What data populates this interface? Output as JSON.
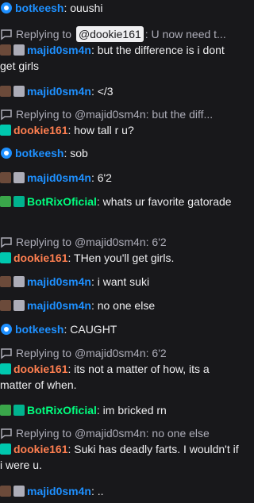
{
  "colors": {
    "background": "#18181b",
    "text": "#efeff1",
    "muted": "#adadb8",
    "botkeesh": "#1e90ff",
    "majid": "#1e90ff",
    "dookie": "#ff7f50",
    "botrix": "#00ff7f"
  },
  "messages": [
    {
      "user": "botkeesh",
      "text": ": ouushi"
    },
    {
      "reply_prefix": "Replying to",
      "reply_mention": "@dookie161",
      "reply_text": ": U now need t...",
      "user": "majid0sm4n",
      "text": ": but the difference is i dont get girls"
    },
    {
      "user": "majid0sm4n",
      "text": ": </3"
    },
    {
      "reply_prefix": "Replying to",
      "reply_text": "@majid0sm4n: but the diff...",
      "user": "dookie161",
      "text": ": how tall r u?"
    },
    {
      "user": "botkeesh",
      "text": ": sob"
    },
    {
      "user": "majid0sm4n",
      "text": ": 6'2"
    },
    {
      "user": "BotRixOficial",
      "text": ": whats ur favorite gatorade"
    },
    {
      "reply_prefix": "Replying to",
      "reply_text": "@majid0sm4n: 6'2",
      "user": "dookie161",
      "text": ": THen you'll get girls."
    },
    {
      "user": "majid0sm4n",
      "text": ": i want suki"
    },
    {
      "user": "majid0sm4n",
      "text": ": no one else"
    },
    {
      "user": "botkeesh",
      "text": ": CAUGHT"
    },
    {
      "reply_prefix": "Replying to",
      "reply_text": "@majid0sm4n: 6'2",
      "user": "dookie161",
      "text": ": its not a matter of how, its a matter of when."
    },
    {
      "user": "BotRixOficial",
      "text": ": im bricked rn"
    },
    {
      "reply_prefix": "Replying to",
      "reply_text": "@majid0sm4n: no one else",
      "user": "dookie161",
      "text": ": Suki has deadly farts. I wouldn't if i were u."
    },
    {
      "user": "majid0sm4n",
      "text": ": .."
    }
  ]
}
